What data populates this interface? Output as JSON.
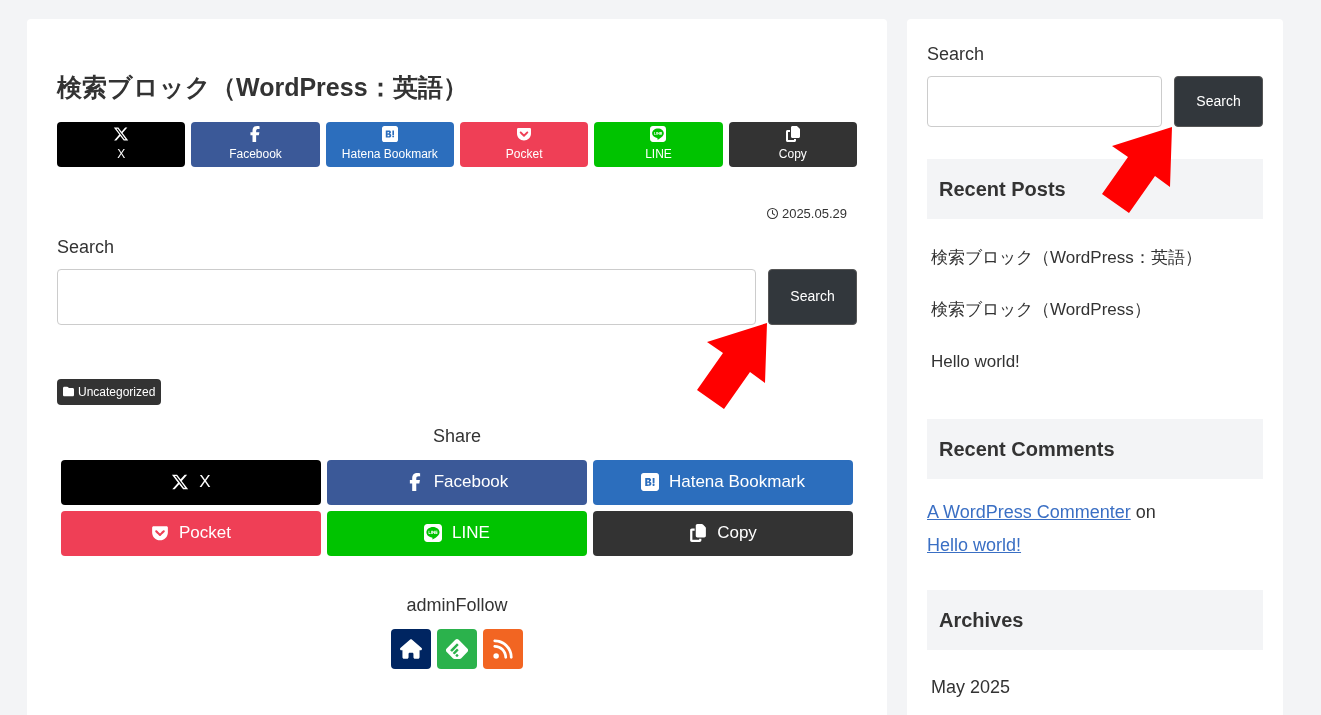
{
  "post": {
    "title": "検索ブロック（WordPress：英語）",
    "share_top": [
      {
        "kind": "x",
        "label": "X",
        "color": "#000000"
      },
      {
        "kind": "facebook",
        "label": "Facebook",
        "color": "#3b5998"
      },
      {
        "kind": "hatena",
        "label": "Hatena Bookmark",
        "color": "#2c6ebd"
      },
      {
        "kind": "pocket",
        "label": "Pocket",
        "color": "#ef3f56"
      },
      {
        "kind": "line",
        "label": "LINE",
        "color": "#00c300"
      },
      {
        "kind": "copy",
        "label": "Copy",
        "color": "#333333"
      }
    ],
    "date": "2025.05.29",
    "search": {
      "label": "Search",
      "button": "Search"
    },
    "category": "Uncategorized",
    "share_heading": "Share",
    "share_bottom": [
      {
        "kind": "x",
        "label": "X",
        "color": "#000000"
      },
      {
        "kind": "facebook",
        "label": "Facebook",
        "color": "#3b5998"
      },
      {
        "kind": "hatena",
        "label": "Hatena Bookmark",
        "color": "#2c6ebd"
      },
      {
        "kind": "pocket",
        "label": "Pocket",
        "color": "#ef3f56"
      },
      {
        "kind": "line",
        "label": "LINE",
        "color": "#00c300"
      },
      {
        "kind": "copy",
        "label": "Copy",
        "color": "#333333"
      }
    ],
    "follow_heading": "adminFollow",
    "follow_icons": [
      {
        "kind": "home",
        "color": "#002561"
      },
      {
        "kind": "feedly",
        "color": "#2bb24c"
      },
      {
        "kind": "rss",
        "color": "#f26522"
      }
    ]
  },
  "sidebar": {
    "search": {
      "label": "Search",
      "button": "Search"
    },
    "recent_posts": {
      "heading": "Recent Posts",
      "items": [
        "検索ブロック（WordPress：英語）",
        "検索ブロック（WordPress）",
        "Hello world!"
      ]
    },
    "recent_comments": {
      "heading": "Recent Comments",
      "author": "A WordPress Commenter",
      "on": "on",
      "post": "Hello world!"
    },
    "archives": {
      "heading": "Archives",
      "items": [
        "May 2025"
      ]
    }
  }
}
